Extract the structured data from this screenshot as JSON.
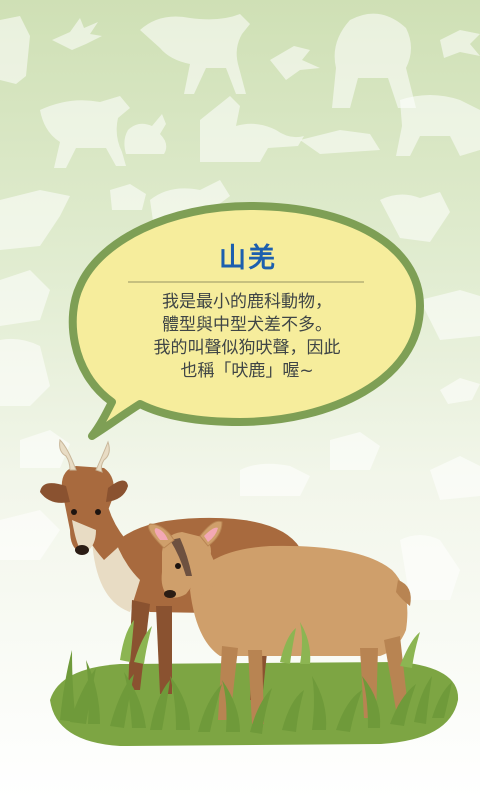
{
  "animal": {
    "name": "山羌",
    "description_lines": [
      "我是最小的鹿科動物，",
      "體型與中型犬差不多。",
      "我的叫聲似狗吠聲，因此",
      "也稱「吠鹿」喔~"
    ]
  },
  "colors": {
    "title": "#1c5fae",
    "bubble_fill": "#f6ed9c",
    "bubble_border": "#7e9f55",
    "male_fur": "#a86a3e",
    "female_fur": "#cf9f6b",
    "grass": "#6f9a3a"
  },
  "icons": [
    "wolf-silhouette",
    "bird-silhouette",
    "bear-silhouette",
    "fox-silhouette",
    "rabbit-silhouette",
    "muntjac-male",
    "muntjac-female",
    "grass-tuft"
  ]
}
